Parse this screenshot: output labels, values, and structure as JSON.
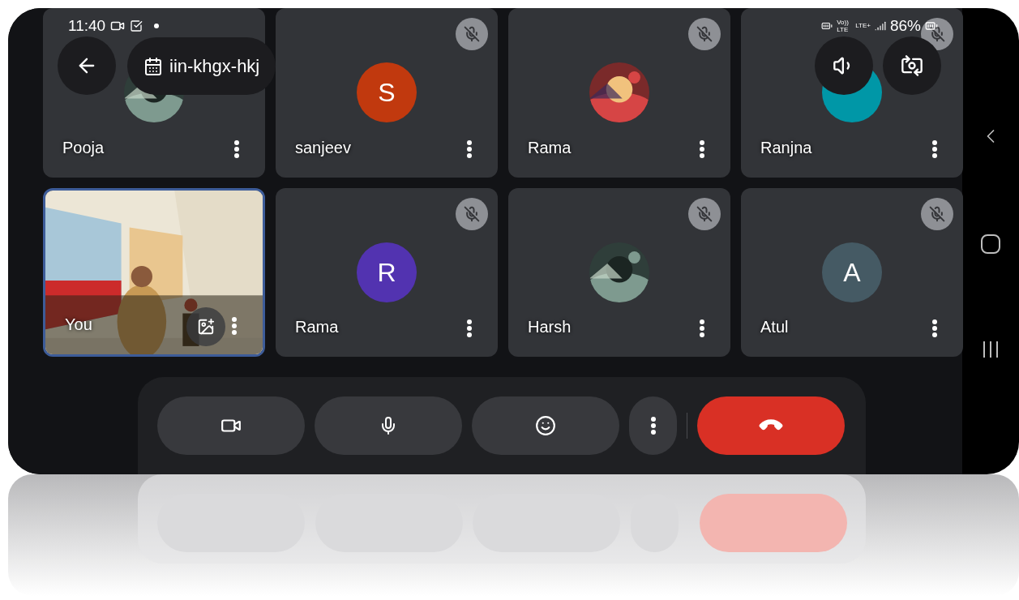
{
  "status_bar": {
    "time": "11:40",
    "network": [
      "Vo))",
      "LTE",
      "LTE+"
    ],
    "battery": "86%"
  },
  "meeting_code": "iin-khgx-hkj",
  "tiles": [
    {
      "kind": "participant",
      "name": "Pooja",
      "muted": false,
      "speaking": false
    },
    {
      "kind": "participant",
      "name": "sanjeev",
      "avatar": {
        "kind": "letter",
        "letter": "S",
        "color": "#c1390e"
      },
      "muted": true,
      "speaking": false
    },
    {
      "kind": "participant",
      "name": "Rama",
      "muted": true,
      "speaking": false
    },
    {
      "kind": "participant",
      "name": "Ranjna",
      "avatar": {
        "kind": "letter",
        "color": "#0097a7"
      },
      "muted": true,
      "speaking": false
    },
    {
      "kind": "self",
      "name": "You",
      "muted": false,
      "speaking": true
    },
    {
      "kind": "participant",
      "name": "Rama",
      "avatar": {
        "kind": "letter",
        "letter": "R",
        "color": "#5233b0"
      },
      "muted": true,
      "speaking": false
    },
    {
      "kind": "participant",
      "name": "Harsh",
      "muted": true,
      "speaking": false
    },
    {
      "kind": "participant",
      "name": "Atul",
      "avatar": {
        "kind": "letter",
        "letter": "A",
        "color": "#455a64"
      },
      "muted": true,
      "speaking": false
    }
  ],
  "controls": [
    {
      "kind": "camera"
    },
    {
      "kind": "mic"
    },
    {
      "kind": "reactions"
    },
    {
      "kind": "more"
    },
    {
      "kind": "end_call"
    }
  ]
}
